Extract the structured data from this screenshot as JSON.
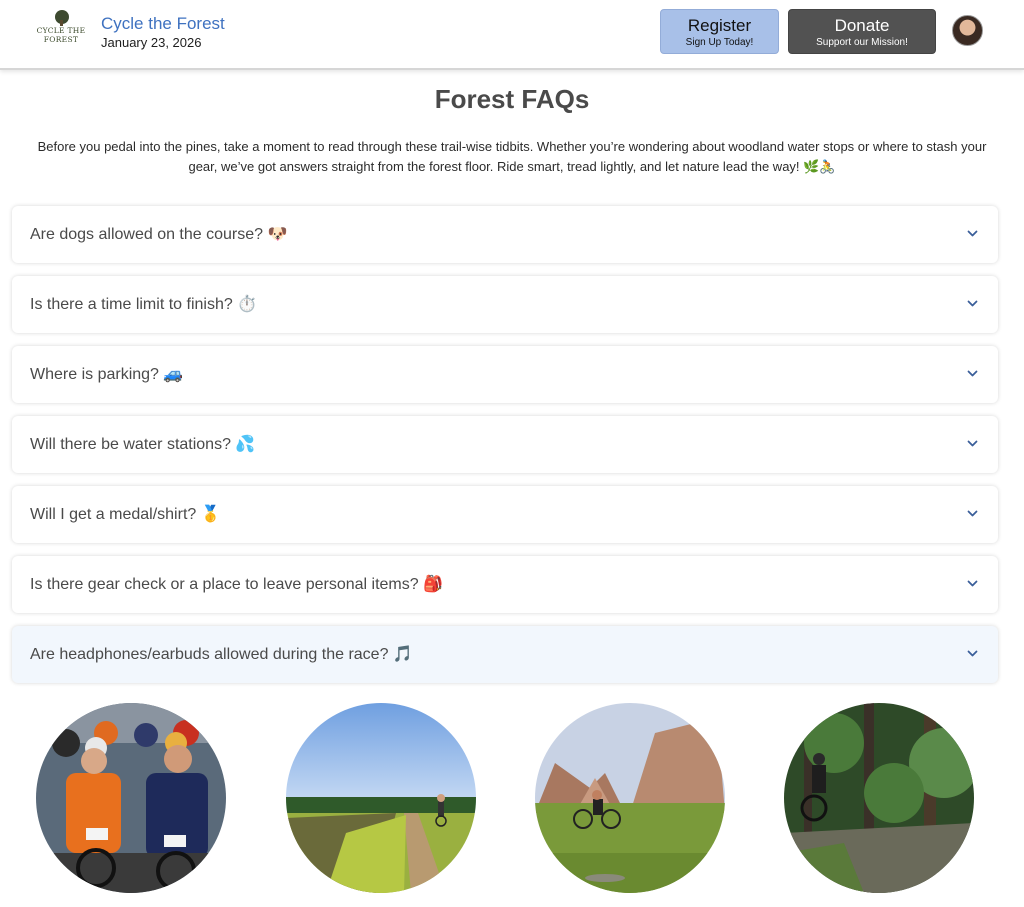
{
  "header": {
    "logo_text_line1": "CYCLE THE",
    "logo_text_line2": "FOREST",
    "site_title": "Cycle the Forest",
    "date": "January 23, 2026",
    "register": {
      "label": "Register",
      "sub": "Sign Up Today!"
    },
    "donate": {
      "label": "Donate",
      "sub": "Support our Mission!"
    }
  },
  "main": {
    "title": "Forest FAQs",
    "intro_line1": "Before you pedal into the pines, take a moment to read through these trail-wise tidbits. Whether you’re wondering about woodland water stops or where to stash your",
    "intro_line2": "gear, we’ve got answers straight from the forest floor. Ride smart, tread lightly, and let nature lead the way! 🌿🚴",
    "faqs": [
      {
        "question": "Are dogs allowed on the course? 🐶"
      },
      {
        "question": "Is there a time limit to finish? ⏱️"
      },
      {
        "question": "Where is parking? 🚙"
      },
      {
        "question": "Will there be water stations? 💦"
      },
      {
        "question": "Will I get a medal/shirt? 🥇"
      },
      {
        "question": "Is there gear check or a place to leave personal items? 🎒"
      },
      {
        "question": "Are headphones/earbuds allowed during the race? 🎵"
      }
    ]
  },
  "colors": {
    "title_blue": "#3f72c0",
    "register_bg": "#a8c0e8",
    "donate_bg": "#525252",
    "chevron": "#3b5f9a",
    "active_faq_bg": "#f2f7fd"
  },
  "icons": {
    "chevron": "chevron-down-icon",
    "avatar": "avatar"
  }
}
